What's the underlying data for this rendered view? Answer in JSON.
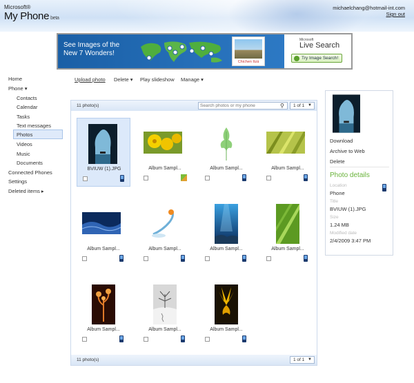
{
  "header": {
    "brand_company": "Microsoft®",
    "brand_product": "My Phone",
    "brand_tag": "beta",
    "user_email": "michaelchang@hotmail-int.com",
    "signout": "Sign out"
  },
  "banner": {
    "headline": "See Images of the New 7 Wonders!",
    "photo_caption": "Chichen Itzá",
    "search_brand_company": "Microsoft",
    "search_brand_name": "Live Search",
    "search_button": "Try Image Search!"
  },
  "nav": {
    "items": [
      "Home",
      "Phone ▾",
      "Contacts",
      "Calendar",
      "Tasks",
      "Text messages",
      "Photos",
      "Videos",
      "Music",
      "Documents",
      "Connected Phones",
      "Settings",
      "Deleted items ▸"
    ]
  },
  "toolbar": {
    "upload": "Upload photo",
    "delete": "Delete ▾",
    "slideshow": "Play slideshow",
    "manage": "Manage ▾"
  },
  "gallery": {
    "count": "11 photo(s)",
    "search_placeholder": "Search photos or my phone",
    "page": "1 of 1",
    "tiles": [
      {
        "label": "BVIUW (1).JPG",
        "icon": "phone"
      },
      {
        "label": "Album Sampl...",
        "icon": "app"
      },
      {
        "label": "Album Sampl...",
        "icon": "phone"
      },
      {
        "label": "Album Sampl...",
        "icon": "phone"
      },
      {
        "label": "Album Sampl...",
        "icon": "phone"
      },
      {
        "label": "Album Sampl...",
        "icon": "phone"
      },
      {
        "label": "Album Sampl...",
        "icon": "phone"
      },
      {
        "label": "Album Sampl...",
        "icon": "phone"
      },
      {
        "label": "Album Sampl...",
        "icon": "phone"
      },
      {
        "label": "Album Sampl...",
        "icon": "phone"
      },
      {
        "label": "Album Sampl...",
        "icon": "phone"
      }
    ]
  },
  "details": {
    "download": "Download",
    "archive": "Archive to Web",
    "delete": "Delete",
    "heading": "Photo details",
    "location_label": "Location",
    "location_value": "Phone",
    "title_label": "Title",
    "title_value": "BVIUW (1).JPG",
    "size_label": "Size",
    "size_value": "1.24 MB",
    "modified_label": "Modified date",
    "modified_value": "2/4/2009 3:47 PM"
  },
  "colors": {
    "accent_green": "#69b33a",
    "selection": "#dce9fa",
    "bar": "#d9e6f6"
  }
}
